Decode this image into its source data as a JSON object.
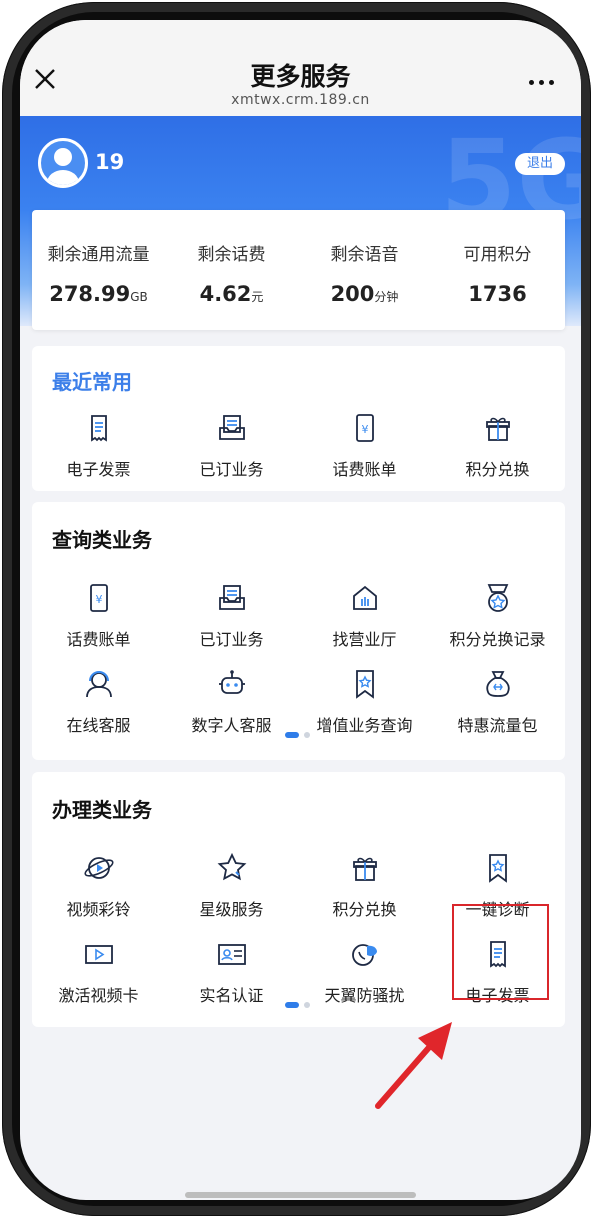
{
  "header": {
    "title": "更多服务",
    "url": "xmtwx.crm.189.cn"
  },
  "banner": {
    "user_number": "19",
    "logout_label": "退出",
    "watermark": "5G"
  },
  "stats": [
    {
      "label": "剩余通用流量",
      "value": "278.99",
      "unit": "GB"
    },
    {
      "label": "剩余话费",
      "value": "4.62",
      "unit": "元"
    },
    {
      "label": "剩余语音",
      "value": "200",
      "unit": "分钟"
    },
    {
      "label": "可用积分",
      "value": "1736",
      "unit": ""
    }
  ],
  "recent": {
    "title": "最近常用",
    "items": [
      {
        "label": "电子发票",
        "icon": "invoice-icon"
      },
      {
        "label": "已订业务",
        "icon": "subscribed-icon"
      },
      {
        "label": "话费账单",
        "icon": "bill-icon"
      },
      {
        "label": "积分兑换",
        "icon": "gift-icon"
      }
    ]
  },
  "query": {
    "title": "查询类业务",
    "items": [
      {
        "label": "话费账单",
        "icon": "bill-icon"
      },
      {
        "label": "已订业务",
        "icon": "subscribed-icon"
      },
      {
        "label": "找营业厅",
        "icon": "store-icon"
      },
      {
        "label": "积分兑换记录",
        "icon": "points-record-icon"
      },
      {
        "label": "在线客服",
        "icon": "headset-icon"
      },
      {
        "label": "数字人客服",
        "icon": "robot-icon"
      },
      {
        "label": "增值业务查询",
        "icon": "bookmark-star-icon"
      },
      {
        "label": "特惠流量包",
        "icon": "bag-icon"
      }
    ]
  },
  "handle": {
    "title": "办理类业务",
    "items": [
      {
        "label": "视频彩铃",
        "icon": "planet-play-icon"
      },
      {
        "label": "星级服务",
        "icon": "star-icon"
      },
      {
        "label": "积分兑换",
        "icon": "gift-icon"
      },
      {
        "label": "一键诊断",
        "icon": "bookmark-star-icon"
      },
      {
        "label": "激活视频卡",
        "icon": "video-card-icon"
      },
      {
        "label": "实名认证",
        "icon": "id-card-icon"
      },
      {
        "label": "天翼防骚扰",
        "icon": "shield-call-icon"
      },
      {
        "label": "电子发票",
        "icon": "invoice-icon"
      }
    ]
  },
  "colors": {
    "accent": "#2f7de9",
    "section_title_blue": "#3c7fe9",
    "highlight": "#d9262b"
  }
}
